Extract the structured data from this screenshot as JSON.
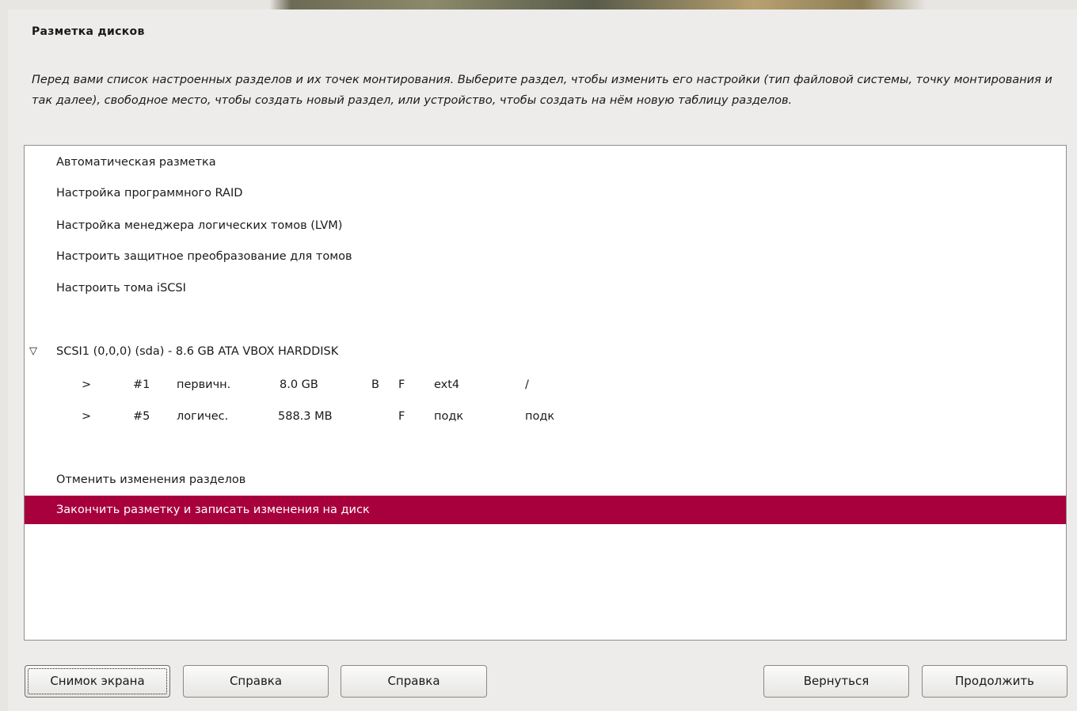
{
  "window": {
    "title": "Разметка дисков",
    "description": "Перед вами список настроенных разделов и их точек монтирования. Выберите раздел, чтобы изменить его настройки (тип файловой системы, точку монтирования и так далее), свободное место, чтобы создать новый раздел, или устройство, чтобы создать на нём новую таблицу разделов."
  },
  "list": {
    "items": [
      {
        "label": "Автоматическая разметка"
      },
      {
        "label": "Настройка программного RAID"
      },
      {
        "label": "Настройка менеджера логических томов (LVM)"
      },
      {
        "label": "Настроить защитное преобразование для томов"
      },
      {
        "label": "Настроить тома iSCSI"
      }
    ],
    "disk": {
      "expander_icon": "triangle-down",
      "expander": "▽",
      "label": "SCSI1 (0,0,0) (sda) - 8.6 GB ATA VBOX HARDDISK",
      "partitions": [
        {
          "arrow": ">",
          "number": "#1",
          "type": "первичн.",
          "size": "8.0 GB",
          "bootable": "B",
          "format": "F",
          "fs": "ext4",
          "mount": "/"
        },
        {
          "arrow": ">",
          "number": "#5",
          "type": "логичес.",
          "size": "588.3 MB",
          "bootable": "",
          "format": "F",
          "fs": "подк",
          "mount": "подк"
        }
      ]
    },
    "undo": "Отменить изменения разделов",
    "finish": "Закончить разметку и записать изменения на диск",
    "selected_color": "#a8003c"
  },
  "buttons": {
    "screenshot": "Снимок экрана",
    "help1": "Справка",
    "help2": "Справка",
    "back": "Вернуться",
    "continue": "Продолжить"
  }
}
